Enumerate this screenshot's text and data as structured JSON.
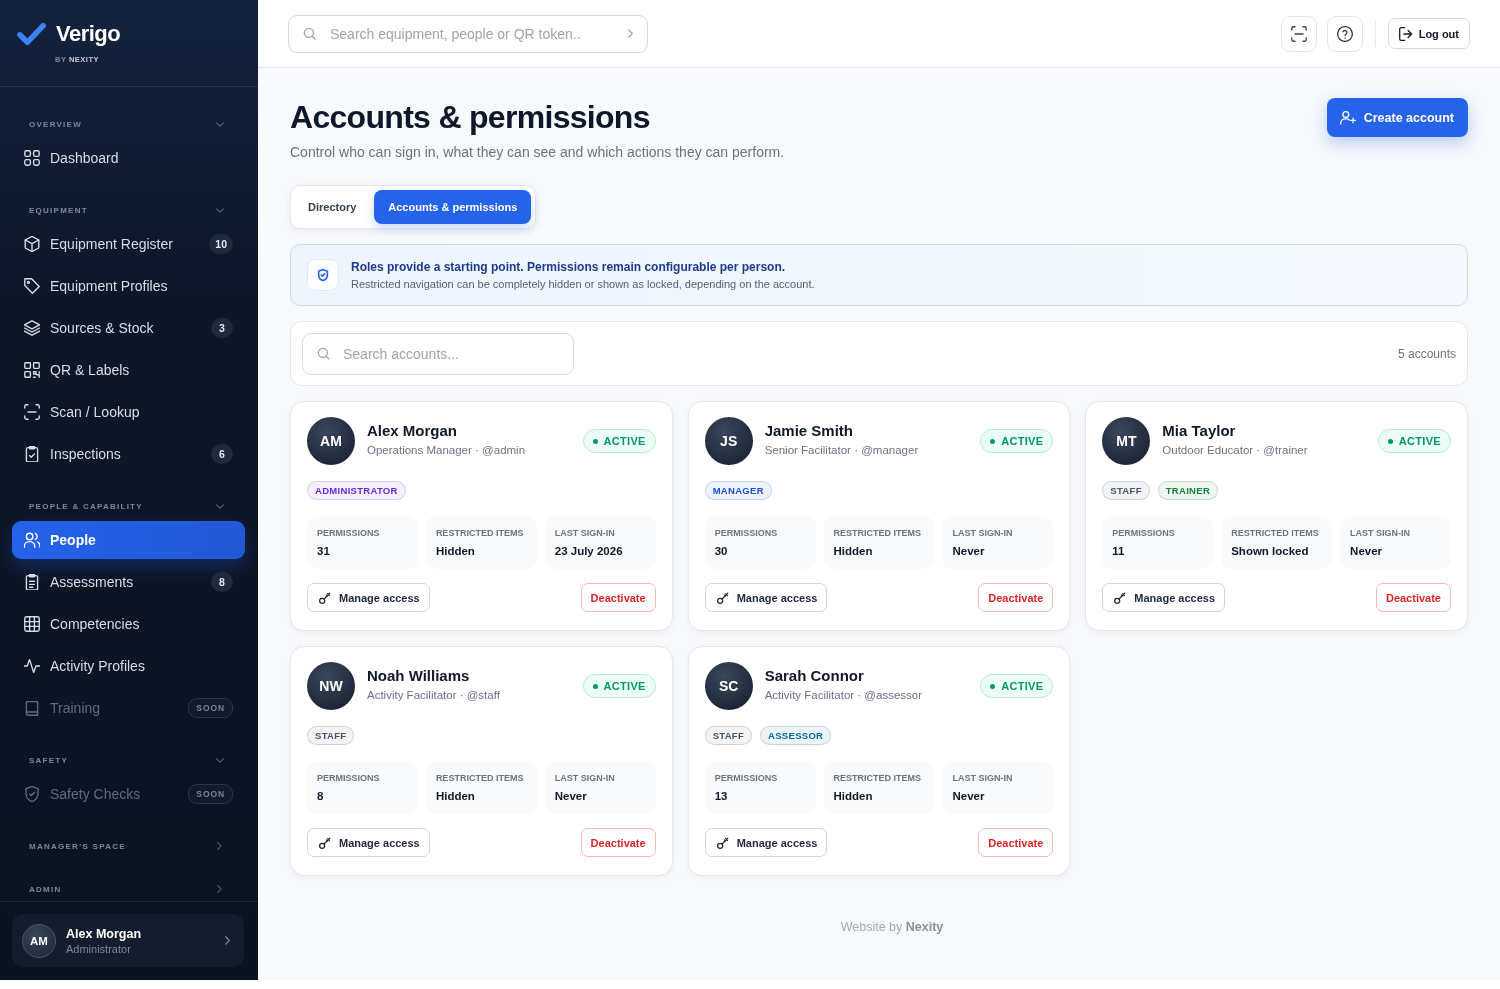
{
  "sidebar": {
    "brand": {
      "name": "Verigo",
      "tagline": "BY **NEXITY**"
    },
    "sections": [
      {
        "title": "OVERVIEW",
        "expanded": true,
        "items": [
          {
            "label": "Dashboard",
            "selected": false,
            "disabled": false
          }
        ]
      },
      {
        "title": "EQUIPMENT",
        "expanded": true,
        "items": [
          {
            "label": "Equipment Register",
            "badge": "10",
            "selected": false,
            "disabled": false
          },
          {
            "label": "Equipment Profiles",
            "selected": false,
            "disabled": false
          },
          {
            "label": "Sources & Stock",
            "badge": "3",
            "selected": false,
            "disabled": false
          },
          {
            "label": "QR & Labels",
            "selected": false,
            "disabled": false
          },
          {
            "label": "Scan / Lookup",
            "selected": false,
            "disabled": false
          },
          {
            "label": "Inspections",
            "badge": "6",
            "selected": false,
            "disabled": false
          }
        ]
      },
      {
        "title": "PEOPLE & CAPABILITY",
        "expanded": true,
        "items": [
          {
            "label": "People",
            "selected": true,
            "disabled": false
          },
          {
            "label": "Assessments",
            "badge": "8",
            "selected": false,
            "disabled": false
          },
          {
            "label": "Competencies",
            "selected": false,
            "disabled": false
          },
          {
            "label": "Activity Profiles",
            "selected": false,
            "disabled": false
          },
          {
            "label": "Training",
            "badge": "SOON",
            "selected": false,
            "disabled": true
          }
        ]
      },
      {
        "title": "SAFETY",
        "expanded": true,
        "items": [
          {
            "label": "Safety Checks",
            "badge": "SOON",
            "selected": false,
            "disabled": true
          }
        ]
      },
      {
        "title": "MANAGER’S SPACE",
        "expanded": false
      },
      {
        "title": "ADMIN",
        "expanded": false
      }
    ],
    "user": {
      "initials": "AM",
      "name": "Alex Morgan",
      "role": "Administrator"
    }
  },
  "header": {
    "search": {
      "placeholder": "Search equipment, people or QR token.."
    },
    "logout": "Log out"
  },
  "page": {
    "title": "Accounts & permissions",
    "subtitle": "Control who can sign in, what they can see and which actions they can perform.",
    "create_button": "Create account",
    "tabs": [
      {
        "label": "Directory",
        "selected": false
      },
      {
        "label": "Accounts & permissions",
        "selected": true
      }
    ],
    "notice": {
      "title": "Roles provide a starting point. Permissions remain configurable per person.",
      "text": "Restricted navigation can be completely hidden or shown as locked, depending on the account."
    },
    "account_search": {
      "placeholder": "Search accounts..."
    },
    "count": "5 accounts",
    "accounts": [
      {
        "initials": "AM",
        "name": "Alex Morgan",
        "subtitle": "Operations Manager · @admin",
        "status": {
          "label": "ACTIVE",
          "active": true
        },
        "tags": [
          {
            "label": "ADMINISTRATOR",
            "color": "#6d28d9"
          }
        ],
        "stats": [
          {
            "label": "PERMISSIONS",
            "value": "31"
          },
          {
            "label": "RESTRICTED ITEMS",
            "value": "Hidden"
          },
          {
            "label": "LAST SIGN-IN",
            "value": "23 July 2026"
          }
        ],
        "actions": {
          "manage": "Manage access",
          "deactivate": "Deactivate"
        }
      },
      {
        "initials": "JS",
        "name": "Jamie Smith",
        "subtitle": "Senior Facilitator · @manager",
        "status": {
          "label": "ACTIVE",
          "active": true
        },
        "tags": [
          {
            "label": "MANAGER",
            "color": "#1d4ed8"
          }
        ],
        "stats": [
          {
            "label": "PERMISSIONS",
            "value": "30"
          },
          {
            "label": "RESTRICTED ITEMS",
            "value": "Hidden"
          },
          {
            "label": "LAST SIGN-IN",
            "value": "Never"
          }
        ],
        "actions": {
          "manage": "Manage access",
          "deactivate": "Deactivate"
        }
      },
      {
        "initials": "MT",
        "name": "Mia Taylor",
        "subtitle": "Outdoor Educator · @trainer",
        "status": {
          "label": "ACTIVE",
          "active": true
        },
        "tags": [
          {
            "label": "STAFF",
            "color": "#475569"
          },
          {
            "label": "TRAINER",
            "color": "#15803d"
          }
        ],
        "stats": [
          {
            "label": "PERMISSIONS",
            "value": "11"
          },
          {
            "label": "RESTRICTED ITEMS",
            "value": "Shown locked"
          },
          {
            "label": "LAST SIGN-IN",
            "value": "Never"
          }
        ],
        "actions": {
          "manage": "Manage access",
          "deactivate": "Deactivate"
        }
      },
      {
        "initials": "NW",
        "name": "Noah Williams",
        "subtitle": "Activity Facilitator · @staff",
        "status": {
          "label": "ACTIVE",
          "active": true
        },
        "tags": [
          {
            "label": "STAFF",
            "color": "#475569"
          }
        ],
        "stats": [
          {
            "label": "PERMISSIONS",
            "value": "8"
          },
          {
            "label": "RESTRICTED ITEMS",
            "value": "Hidden"
          },
          {
            "label": "LAST SIGN-IN",
            "value": "Never"
          }
        ],
        "actions": {
          "manage": "Manage access",
          "deactivate": "Deactivate"
        }
      },
      {
        "initials": "SC",
        "name": "Sarah Connor",
        "subtitle": "Activity Facilitator · @assessor",
        "status": {
          "label": "ACTIVE",
          "active": true
        },
        "tags": [
          {
            "label": "STAFF",
            "color": "#475569"
          },
          {
            "label": "ASSESSOR",
            "color": "#0369a1"
          }
        ],
        "stats": [
          {
            "label": "PERMISSIONS",
            "value": "13"
          },
          {
            "label": "RESTRICTED ITEMS",
            "value": "Hidden"
          },
          {
            "label": "LAST SIGN-IN",
            "value": "Never"
          }
        ],
        "actions": {
          "manage": "Manage access",
          "deactivate": "Deactivate"
        }
      }
    ]
  },
  "footer": "Website by **Nexity**"
}
